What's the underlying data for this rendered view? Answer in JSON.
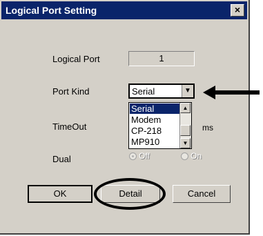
{
  "dialog": {
    "title": "Logical Port Setting",
    "close_glyph": "×",
    "logical_port": {
      "label": "Logical Port",
      "value": "1"
    },
    "port_kind": {
      "label": "Port Kind",
      "selected": "Serial",
      "dropdown_glyph": "▼",
      "options": [
        "Serial",
        "Modem",
        "CP-218",
        "MP910"
      ],
      "scroll_up_glyph": "▲",
      "scroll_down_glyph": "▼"
    },
    "timeout": {
      "label": "TimeOut",
      "unit": "ms"
    },
    "dual": {
      "label": "Dual",
      "off": "Off",
      "on": "On"
    },
    "buttons": {
      "ok": "OK",
      "detail": "Detail",
      "cancel": "Cancel"
    }
  },
  "colors": {
    "titlebar": "#0a246a",
    "dialog_bg": "#d4d0c8",
    "selection": "#0a246a"
  }
}
